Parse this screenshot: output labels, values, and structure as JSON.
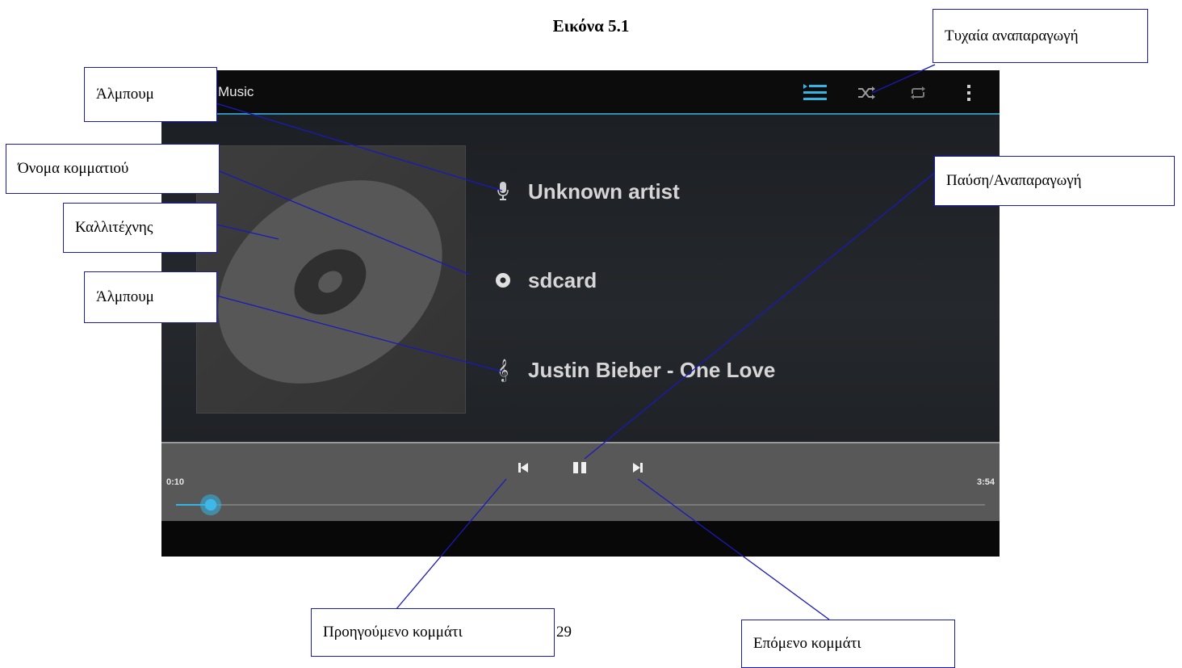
{
  "figure": {
    "title": "Εικόνα 5.1",
    "page_number": "29"
  },
  "screen": {
    "app_title": "Music",
    "action_icons": [
      "playlist-icon",
      "shuffle-icon",
      "repeat-icon",
      "overflow-menu-icon"
    ],
    "track_info": {
      "artist": "Unknown artist",
      "album": "sdcard",
      "song": "Justin Bieber - One Love"
    },
    "playback": {
      "elapsed": "0:10",
      "total": "3:54",
      "progress_fraction": 0.043,
      "state": "playing"
    },
    "colors": {
      "accent": "#33b5e5",
      "background": "#000000",
      "controls_bg": "#585858"
    }
  },
  "callouts": {
    "album_top": "Άλμπουμ",
    "song_name": "Όνομα κομματιού",
    "artist": "Καλλιτέχνης",
    "album_bottom": "Άλμπουμ",
    "shuffle": "Τυχαία αναπαραγωγή",
    "pause_play": "Παύση/Αναπαραγωγή",
    "previous": "Προηγούμενο κομμάτι",
    "next": "Επόμενο κομμάτι"
  }
}
